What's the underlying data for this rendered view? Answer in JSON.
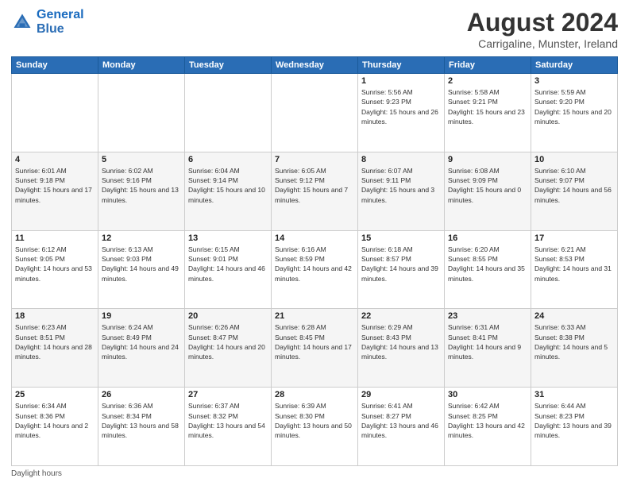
{
  "header": {
    "logo_line1": "General",
    "logo_line2": "Blue",
    "month_year": "August 2024",
    "location": "Carrigaline, Munster, Ireland"
  },
  "days_of_week": [
    "Sunday",
    "Monday",
    "Tuesday",
    "Wednesday",
    "Thursday",
    "Friday",
    "Saturday"
  ],
  "weeks": [
    [
      {
        "day": "",
        "sunrise": "",
        "sunset": "",
        "daylight": ""
      },
      {
        "day": "",
        "sunrise": "",
        "sunset": "",
        "daylight": ""
      },
      {
        "day": "",
        "sunrise": "",
        "sunset": "",
        "daylight": ""
      },
      {
        "day": "",
        "sunrise": "",
        "sunset": "",
        "daylight": ""
      },
      {
        "day": "1",
        "sunrise": "Sunrise: 5:56 AM",
        "sunset": "Sunset: 9:23 PM",
        "daylight": "Daylight: 15 hours and 26 minutes."
      },
      {
        "day": "2",
        "sunrise": "Sunrise: 5:58 AM",
        "sunset": "Sunset: 9:21 PM",
        "daylight": "Daylight: 15 hours and 23 minutes."
      },
      {
        "day": "3",
        "sunrise": "Sunrise: 5:59 AM",
        "sunset": "Sunset: 9:20 PM",
        "daylight": "Daylight: 15 hours and 20 minutes."
      }
    ],
    [
      {
        "day": "4",
        "sunrise": "Sunrise: 6:01 AM",
        "sunset": "Sunset: 9:18 PM",
        "daylight": "Daylight: 15 hours and 17 minutes."
      },
      {
        "day": "5",
        "sunrise": "Sunrise: 6:02 AM",
        "sunset": "Sunset: 9:16 PM",
        "daylight": "Daylight: 15 hours and 13 minutes."
      },
      {
        "day": "6",
        "sunrise": "Sunrise: 6:04 AM",
        "sunset": "Sunset: 9:14 PM",
        "daylight": "Daylight: 15 hours and 10 minutes."
      },
      {
        "day": "7",
        "sunrise": "Sunrise: 6:05 AM",
        "sunset": "Sunset: 9:12 PM",
        "daylight": "Daylight: 15 hours and 7 minutes."
      },
      {
        "day": "8",
        "sunrise": "Sunrise: 6:07 AM",
        "sunset": "Sunset: 9:11 PM",
        "daylight": "Daylight: 15 hours and 3 minutes."
      },
      {
        "day": "9",
        "sunrise": "Sunrise: 6:08 AM",
        "sunset": "Sunset: 9:09 PM",
        "daylight": "Daylight: 15 hours and 0 minutes."
      },
      {
        "day": "10",
        "sunrise": "Sunrise: 6:10 AM",
        "sunset": "Sunset: 9:07 PM",
        "daylight": "Daylight: 14 hours and 56 minutes."
      }
    ],
    [
      {
        "day": "11",
        "sunrise": "Sunrise: 6:12 AM",
        "sunset": "Sunset: 9:05 PM",
        "daylight": "Daylight: 14 hours and 53 minutes."
      },
      {
        "day": "12",
        "sunrise": "Sunrise: 6:13 AM",
        "sunset": "Sunset: 9:03 PM",
        "daylight": "Daylight: 14 hours and 49 minutes."
      },
      {
        "day": "13",
        "sunrise": "Sunrise: 6:15 AM",
        "sunset": "Sunset: 9:01 PM",
        "daylight": "Daylight: 14 hours and 46 minutes."
      },
      {
        "day": "14",
        "sunrise": "Sunrise: 6:16 AM",
        "sunset": "Sunset: 8:59 PM",
        "daylight": "Daylight: 14 hours and 42 minutes."
      },
      {
        "day": "15",
        "sunrise": "Sunrise: 6:18 AM",
        "sunset": "Sunset: 8:57 PM",
        "daylight": "Daylight: 14 hours and 39 minutes."
      },
      {
        "day": "16",
        "sunrise": "Sunrise: 6:20 AM",
        "sunset": "Sunset: 8:55 PM",
        "daylight": "Daylight: 14 hours and 35 minutes."
      },
      {
        "day": "17",
        "sunrise": "Sunrise: 6:21 AM",
        "sunset": "Sunset: 8:53 PM",
        "daylight": "Daylight: 14 hours and 31 minutes."
      }
    ],
    [
      {
        "day": "18",
        "sunrise": "Sunrise: 6:23 AM",
        "sunset": "Sunset: 8:51 PM",
        "daylight": "Daylight: 14 hours and 28 minutes."
      },
      {
        "day": "19",
        "sunrise": "Sunrise: 6:24 AM",
        "sunset": "Sunset: 8:49 PM",
        "daylight": "Daylight: 14 hours and 24 minutes."
      },
      {
        "day": "20",
        "sunrise": "Sunrise: 6:26 AM",
        "sunset": "Sunset: 8:47 PM",
        "daylight": "Daylight: 14 hours and 20 minutes."
      },
      {
        "day": "21",
        "sunrise": "Sunrise: 6:28 AM",
        "sunset": "Sunset: 8:45 PM",
        "daylight": "Daylight: 14 hours and 17 minutes."
      },
      {
        "day": "22",
        "sunrise": "Sunrise: 6:29 AM",
        "sunset": "Sunset: 8:43 PM",
        "daylight": "Daylight: 14 hours and 13 minutes."
      },
      {
        "day": "23",
        "sunrise": "Sunrise: 6:31 AM",
        "sunset": "Sunset: 8:41 PM",
        "daylight": "Daylight: 14 hours and 9 minutes."
      },
      {
        "day": "24",
        "sunrise": "Sunrise: 6:33 AM",
        "sunset": "Sunset: 8:38 PM",
        "daylight": "Daylight: 14 hours and 5 minutes."
      }
    ],
    [
      {
        "day": "25",
        "sunrise": "Sunrise: 6:34 AM",
        "sunset": "Sunset: 8:36 PM",
        "daylight": "Daylight: 14 hours and 2 minutes."
      },
      {
        "day": "26",
        "sunrise": "Sunrise: 6:36 AM",
        "sunset": "Sunset: 8:34 PM",
        "daylight": "Daylight: 13 hours and 58 minutes."
      },
      {
        "day": "27",
        "sunrise": "Sunrise: 6:37 AM",
        "sunset": "Sunset: 8:32 PM",
        "daylight": "Daylight: 13 hours and 54 minutes."
      },
      {
        "day": "28",
        "sunrise": "Sunrise: 6:39 AM",
        "sunset": "Sunset: 8:30 PM",
        "daylight": "Daylight: 13 hours and 50 minutes."
      },
      {
        "day": "29",
        "sunrise": "Sunrise: 6:41 AM",
        "sunset": "Sunset: 8:27 PM",
        "daylight": "Daylight: 13 hours and 46 minutes."
      },
      {
        "day": "30",
        "sunrise": "Sunrise: 6:42 AM",
        "sunset": "Sunset: 8:25 PM",
        "daylight": "Daylight: 13 hours and 42 minutes."
      },
      {
        "day": "31",
        "sunrise": "Sunrise: 6:44 AM",
        "sunset": "Sunset: 8:23 PM",
        "daylight": "Daylight: 13 hours and 39 minutes."
      }
    ]
  ],
  "footer": {
    "daylight_label": "Daylight hours"
  }
}
